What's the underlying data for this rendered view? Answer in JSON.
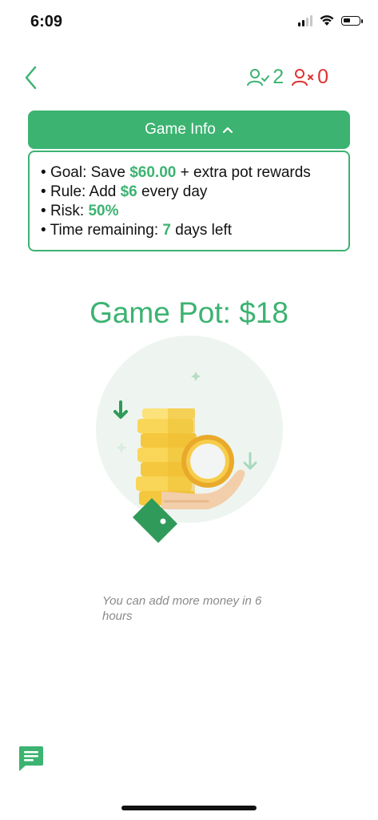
{
  "status_bar": {
    "time": "6:09",
    "signal_bars": 4,
    "signal_active": 2,
    "battery_level": 0.45
  },
  "header": {
    "back_icon": "chevron-left-icon",
    "players_ok_count": "2",
    "players_out_count": "0"
  },
  "game_info": {
    "title": "Game Info",
    "goal_prefix": "Goal: Save ",
    "goal_amount": "$60.00",
    "goal_suffix": " + extra pot rewards",
    "rule_prefix": "Rule: Add ",
    "rule_amount": "$6",
    "rule_suffix": " every day",
    "risk_prefix": "Risk: ",
    "risk_value": "50%",
    "time_prefix": "Time remaining: ",
    "time_value": "7",
    "time_suffix": " days left"
  },
  "pot": {
    "title": "Game Pot: $18"
  },
  "hint": "You can add more money in 6 hours",
  "colors": {
    "accent": "#3cb371",
    "danger": "#e03131",
    "hint_text": "#8a8a8a"
  }
}
